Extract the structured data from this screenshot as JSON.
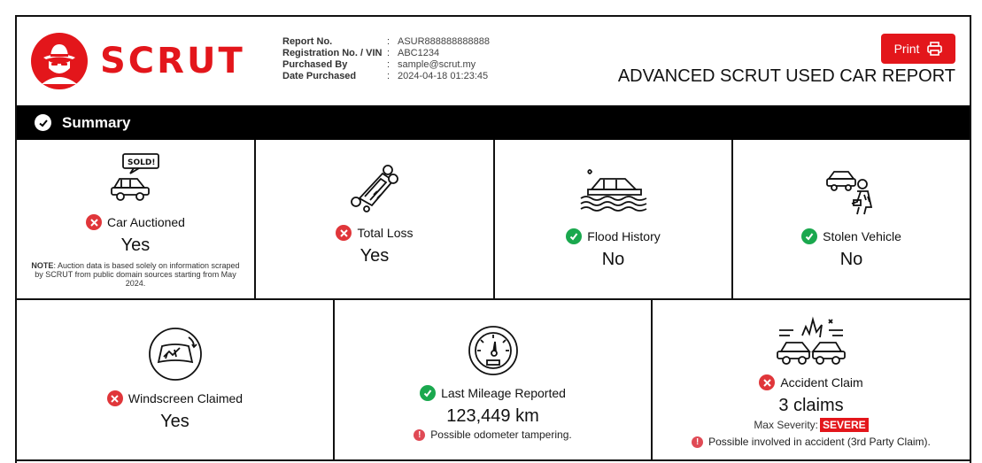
{
  "brand": {
    "name": "SCRUT",
    "color": "#e3161b"
  },
  "meta": [
    {
      "label": "Report No.",
      "value": "ASUR888888888888"
    },
    {
      "label": "Registration No. / VIN",
      "value": "ABC1234"
    },
    {
      "label": "Purchased By",
      "value": "sample@scrut.my"
    },
    {
      "label": "Date Purchased",
      "value": "2024-04-18 01:23:45"
    }
  ],
  "print_label": "Print",
  "report_title": "ADVANCED SCRUT USED CAR REPORT",
  "summary_title": "Summary",
  "cards": {
    "auctioned": {
      "label": "Car Auctioned",
      "value": "Yes",
      "status": "bad",
      "icon": "sold-car-icon",
      "note_bold": "NOTE",
      "note": ": Auction data is based solely on information scraped by SCRUT from public domain sources starting from May 2024."
    },
    "total_loss": {
      "label": "Total Loss",
      "value": "Yes",
      "status": "bad",
      "icon": "overturned-car-icon"
    },
    "flood": {
      "label": "Flood History",
      "value": "No",
      "status": "good",
      "icon": "flooded-car-icon"
    },
    "stolen": {
      "label": "Stolen Vehicle",
      "value": "No",
      "status": "good",
      "icon": "thief-car-icon"
    },
    "windscreen": {
      "label": "Windscreen Claimed",
      "value": "Yes",
      "status": "bad",
      "icon": "windscreen-icon"
    },
    "mileage": {
      "label": "Last Mileage Reported",
      "value": "123,449 km",
      "status": "good",
      "icon": "speedometer-icon",
      "warning": "Possible odometer tampering."
    },
    "accident": {
      "label": "Accident Claim",
      "value": "3 claims",
      "status": "bad",
      "icon": "car-crash-icon",
      "severity_label": "Max Severity:",
      "severity": "SEVERE",
      "warning": "Possible involved in accident (3rd Party Claim)."
    }
  },
  "colors": {
    "bad": "#e0363a",
    "good": "#1aa84e",
    "warning": "#e04a55"
  }
}
